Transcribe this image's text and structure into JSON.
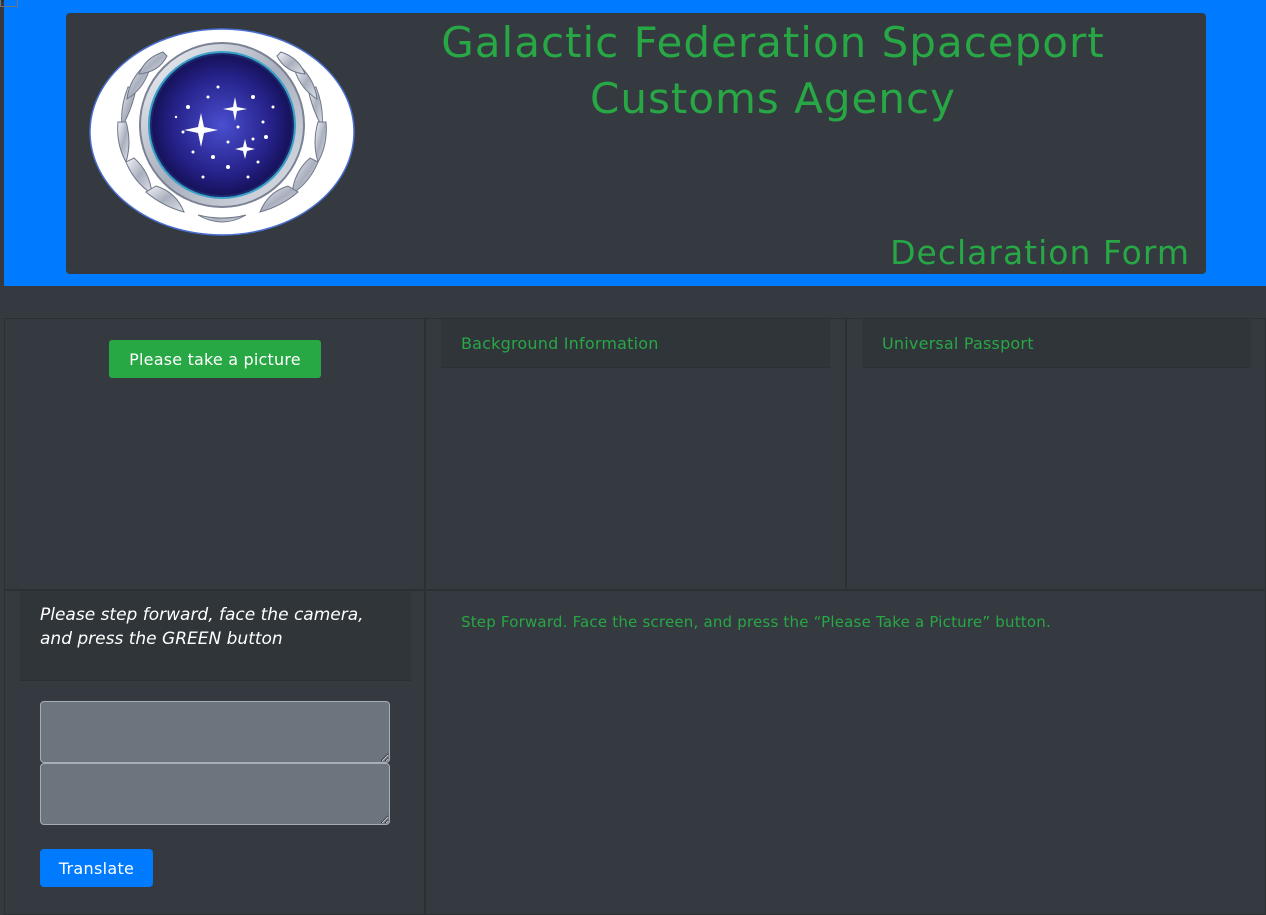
{
  "header": {
    "title": "Galactic Federation Spaceport Customs Agency",
    "subtitle": "Declaration Form",
    "emblem_icon": "federation-emblem-icon"
  },
  "camera_panel": {
    "picture_button_label": "Please take a picture"
  },
  "background_panel": {
    "heading": "Background Information"
  },
  "passport_panel": {
    "heading": "Universal Passport"
  },
  "instructions_panel": {
    "text": "Please step forward, face the camera, and press the GREEN button",
    "input_1_value": "",
    "input_2_value": "",
    "translate_button_label": "Translate"
  },
  "status_panel": {
    "message": "Step Forward. Face the screen, and press the “Please Take a Picture” button."
  },
  "colors": {
    "accent_green": "#28a745",
    "band_blue": "#007bff",
    "panel_bg": "#343a40",
    "input_bg": "#6c757d"
  }
}
